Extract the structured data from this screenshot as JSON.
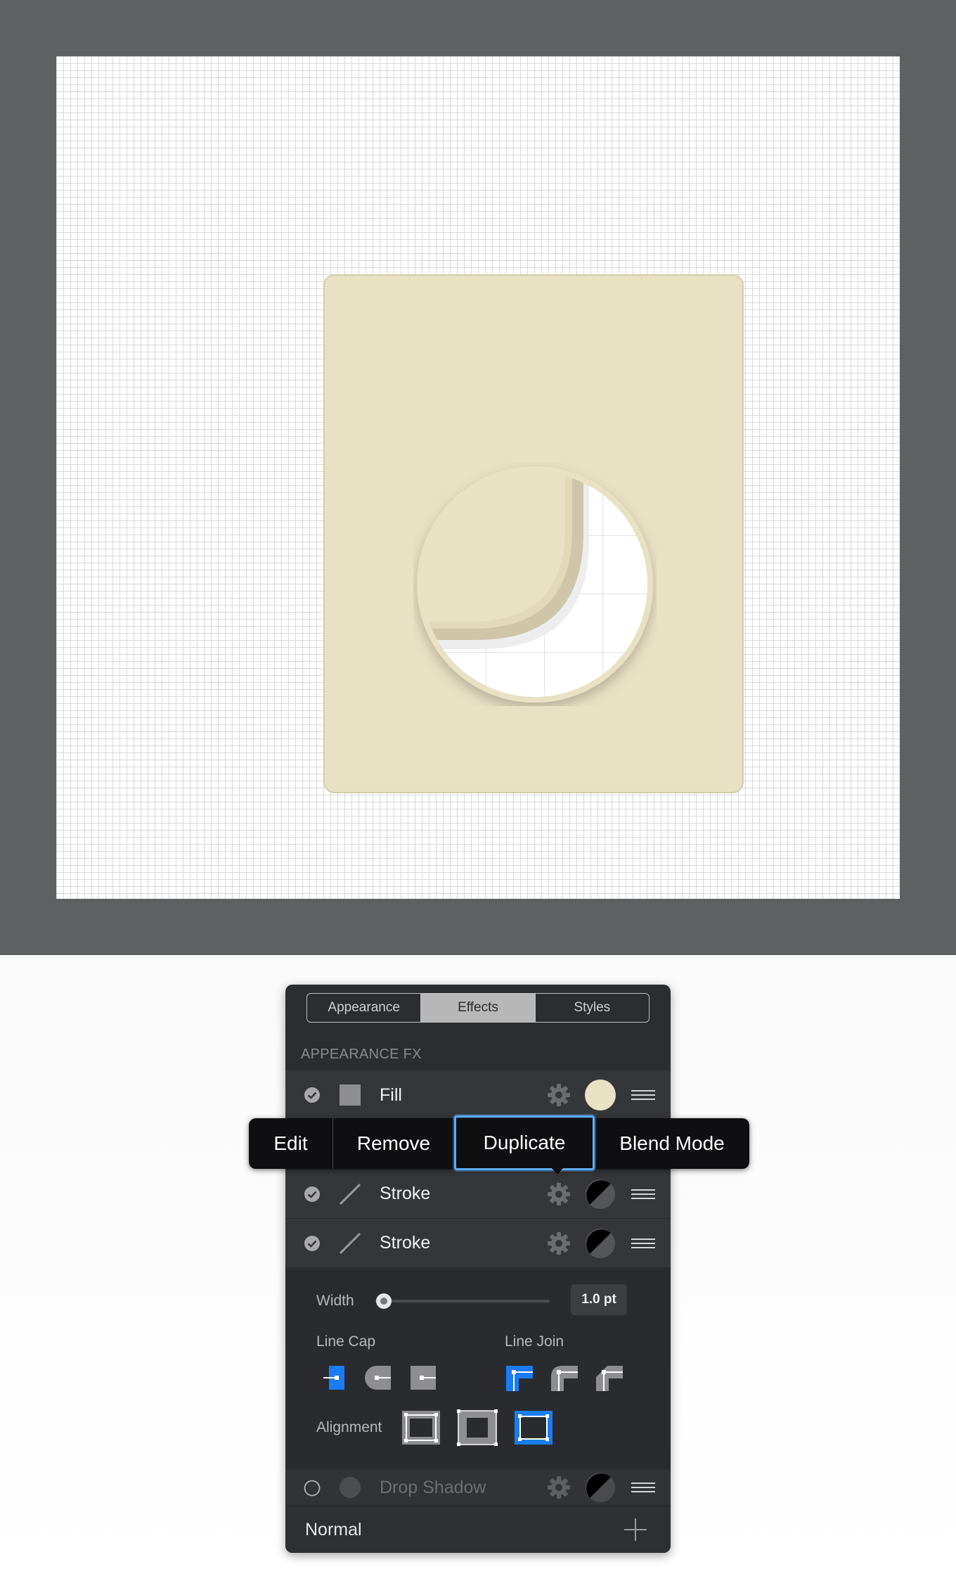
{
  "panel": {
    "tabs": [
      {
        "label": "Appearance",
        "active": false
      },
      {
        "label": "Effects",
        "active": true
      },
      {
        "label": "Styles",
        "active": false
      }
    ],
    "section_title": "APPEARANCE FX",
    "rows": [
      {
        "label": "Fill",
        "enabled": true,
        "swatch": "#e9e1c4",
        "icon": "fill-square-icon"
      },
      {
        "label": "Stroke",
        "enabled": true,
        "swatch": "black-half",
        "icon": "stroke-line-icon"
      },
      {
        "label": "Stroke",
        "enabled": true,
        "swatch": "black-half",
        "icon": "stroke-line-icon"
      },
      {
        "label": "Drop Shadow",
        "enabled": false,
        "swatch": "black-half",
        "icon": "shadow-circle-icon"
      }
    ],
    "stroke": {
      "width_label": "Width",
      "width_value": "1.0 pt",
      "line_cap_label": "Line Cap",
      "line_join_label": "Line Join",
      "alignment_label": "Alignment",
      "selected_cap": "butt",
      "selected_join": "miter",
      "selected_alignment": "outside"
    },
    "footer": {
      "blend_mode": "Normal",
      "add_icon": "plus-icon"
    }
  },
  "context_menu": {
    "items": [
      {
        "label": "Edit",
        "selected": false
      },
      {
        "label": "Remove",
        "selected": false
      },
      {
        "label": "Duplicate",
        "selected": true
      },
      {
        "label": "Blend Mode",
        "selected": false
      }
    ]
  },
  "colors": {
    "card_fill": "#e9e1c4",
    "workspace": "#5f6062",
    "panel": "#2c2d30",
    "accent_blue": "#1a7cf5",
    "menu_highlight": "#5aaeff"
  }
}
